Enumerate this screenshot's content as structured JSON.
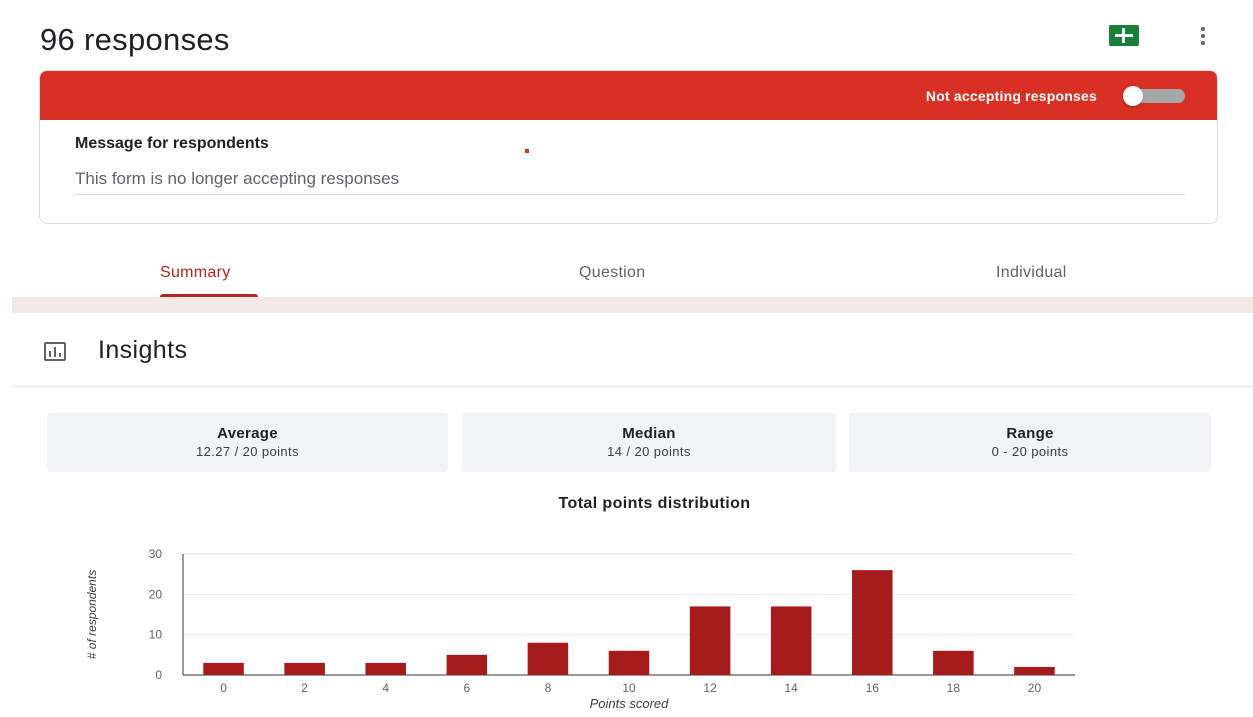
{
  "header": {
    "title": "96 responses",
    "sheets_icon": "google-sheets-icon",
    "more_icon": "more-vert-icon"
  },
  "accepting": {
    "status_label": "Not accepting responses",
    "toggle_on": false,
    "message_label": "Message for respondents",
    "message_value": "This form is no longer accepting responses",
    "bar_color": "#d93025"
  },
  "tabs": [
    {
      "label": "Summary",
      "active": true
    },
    {
      "label": "Question",
      "active": false
    },
    {
      "label": "Individual",
      "active": false
    }
  ],
  "insights": {
    "title": "Insights",
    "icon": "insights-chart-icon",
    "stats": [
      {
        "label": "Average",
        "value": "12.27 / 20 points"
      },
      {
        "label": "Median",
        "value": "14 / 20 points"
      },
      {
        "label": "Range",
        "value": "0 - 20 points"
      }
    ]
  },
  "chart_data": {
    "type": "bar",
    "title": "Total points distribution",
    "xlabel": "Points scored",
    "ylabel": "# of respondents",
    "categories": [
      "0",
      "2",
      "4",
      "6",
      "8",
      "10",
      "12",
      "14",
      "16",
      "18",
      "20"
    ],
    "values": [
      3,
      3,
      3,
      5,
      8,
      6,
      17,
      17,
      26,
      6,
      2
    ],
    "yticks": [
      "0",
      "10",
      "20",
      "30"
    ],
    "ylim": [
      0,
      30
    ],
    "grid": true,
    "bar_color": "#a61c1c"
  }
}
